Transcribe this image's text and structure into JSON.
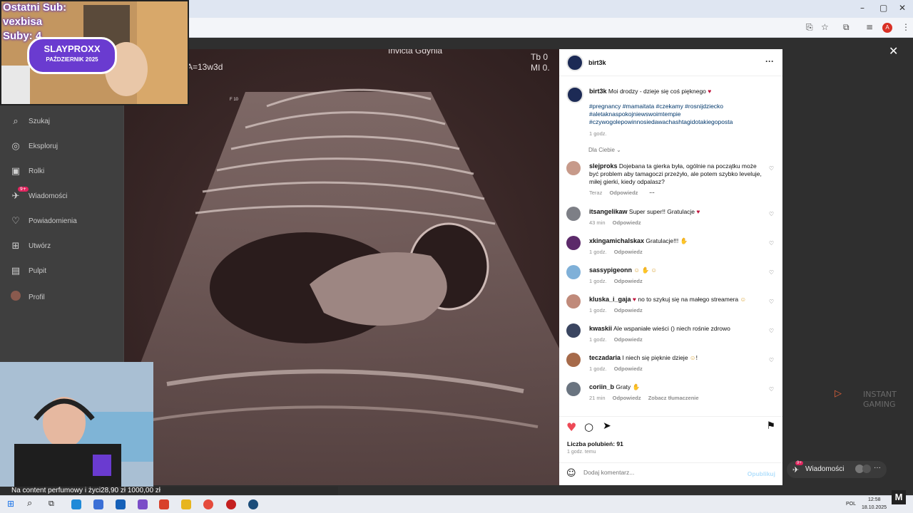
{
  "stream": {
    "last_sub_label": "Ostatni Sub:",
    "last_sub_name": "vexbisa",
    "subs_label": "Suby: 4",
    "brand": "SLAYPROXX",
    "brand_sub": "PAŹDZIERNIK 2025",
    "ticker": "Na content perfumowy i życi28,90 zł    1000,00 zł"
  },
  "sidebar": {
    "items": [
      {
        "icon": "search-icon",
        "label": "Szukaj"
      },
      {
        "icon": "compass-icon",
        "label": "Eksploruj"
      },
      {
        "icon": "reels-icon",
        "label": "Rolki"
      },
      {
        "icon": "messenger-icon",
        "label": "Wiadomości",
        "badge": "9+"
      },
      {
        "icon": "heart-icon",
        "label": "Powiadomienia"
      },
      {
        "icon": "plus-square-icon",
        "label": "Utwórz"
      },
      {
        "icon": "dashboard-icon",
        "label": "Pulpit"
      },
      {
        "icon": "profile-icon",
        "label": "Profil"
      }
    ]
  },
  "ultrasound": {
    "title": "Invicta Gdynia",
    "ga": "A=13w3d",
    "tib": "Tb 0",
    "mi": "MI 0.",
    "scale": "F 10"
  },
  "post": {
    "author": "birt3k",
    "caption_text": "Moi drodzy - dzieje się coś pięknego",
    "hashtags": "#pregnancy #mamaitata #czekamy #rosnijdziecko #aletaknaspokojniewswoimtempie #czywogolepowinnosiedawachashtagidotakiegoposta",
    "caption_time": "1 godz.",
    "sort_label": "Dla Ciebie",
    "reply_label": "Odpowiedz",
    "translate_label": "Zobacz tłumaczenie",
    "comments": [
      {
        "user": "slejproks",
        "text": "Dojebana ta gierka była, ogólnie na początku może być problem aby tamagoczi przeżyło, ale potem szybko leveluje, miłej gierki, kiedy odpalasz?",
        "time": "Teraz",
        "color": "#c79a8a"
      },
      {
        "user": "itsangelikaw",
        "text": "Super super!! Gratulacje",
        "time": "43 min",
        "color": "#7d7f86"
      },
      {
        "user": "xkingamichalskax",
        "text": "Gratulacje!!!",
        "time": "1 godz.",
        "color": "#5c2a6a"
      },
      {
        "user": "sassypigeonn",
        "text": "",
        "time": "1 godz.",
        "color": "#7fb0d8"
      },
      {
        "user": "kluska_i_gaja",
        "text": "no to szykuj się na małego streamera",
        "time": "1 godz.",
        "color": "#c08a7a"
      },
      {
        "user": "kwaskii",
        "text": "Ale wspaniałe wieści () niech rośnie zdrowo",
        "time": "1 godz.",
        "color": "#3a4560"
      },
      {
        "user": "teczadaria",
        "text": "I niech się pięknie dzieje",
        "time": "1 godz.",
        "color": "#a66a4a"
      },
      {
        "user": "coriin_b",
        "text": "Graty",
        "time": "21 min",
        "color": "#6a7480"
      }
    ],
    "likes": "Liczba polubień: 91",
    "posted": "1 godz. temu",
    "add_comment_placeholder": "Dodaj komentarz...",
    "publish_label": "Opublikuj"
  },
  "dm_pill": {
    "label": "Wiadomości",
    "badge": "9+"
  },
  "watermark": {
    "line1": "INSTANT",
    "line2": "GAMING"
  },
  "taskbar": {
    "lang": "POL",
    "time": "12:58",
    "date": "18.10.2025"
  },
  "colors": {
    "accent_heart": "#ed4956",
    "link_blue": "#00376b"
  }
}
